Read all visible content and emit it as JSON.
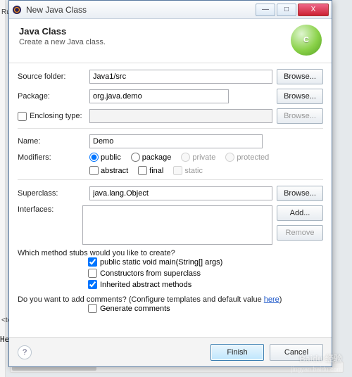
{
  "bg": {
    "run": "Run",
    "tab": "<tern",
    "hello": "Hel"
  },
  "titlebar": {
    "title": "New Java Class",
    "min": "—",
    "max": "□",
    "close": "X"
  },
  "header": {
    "title": "Java Class",
    "subtitle": "Create a new Java class.",
    "icon_letter": "C"
  },
  "form": {
    "source_folder_label": "Source folder:",
    "source_folder_value": "Java1/src",
    "package_label": "Package:",
    "package_value": "org.java.demo",
    "enclosing_label": "Enclosing type:",
    "enclosing_checked": false,
    "name_label": "Name:",
    "name_value": "Demo",
    "modifiers_label": "Modifiers:",
    "mod_public": "public",
    "mod_package": "package",
    "mod_private": "private",
    "mod_protected": "protected",
    "mod_abstract": "abstract",
    "mod_final": "final",
    "mod_static": "static",
    "superclass_label": "Superclass:",
    "superclass_value": "java.lang.Object",
    "interfaces_label": "Interfaces:",
    "stubs_question": "Which method stubs would you like to create?",
    "stub_main": "public static void main(String[] args)",
    "stub_constructors": "Constructors from superclass",
    "stub_inherited": "Inherited abstract methods",
    "comments_question_pre": "Do you want to add comments? (Configure templates and default value ",
    "comments_here": "here",
    "comments_question_post": ")",
    "generate_comments": "Generate comments"
  },
  "buttons": {
    "browse": "Browse...",
    "add": "Add...",
    "remove": "Remove",
    "finish": "Finish",
    "cancel": "Cancel"
  },
  "watermark": {
    "main": "Baidu 经验",
    "sub": "jingyan.baidu.com"
  }
}
